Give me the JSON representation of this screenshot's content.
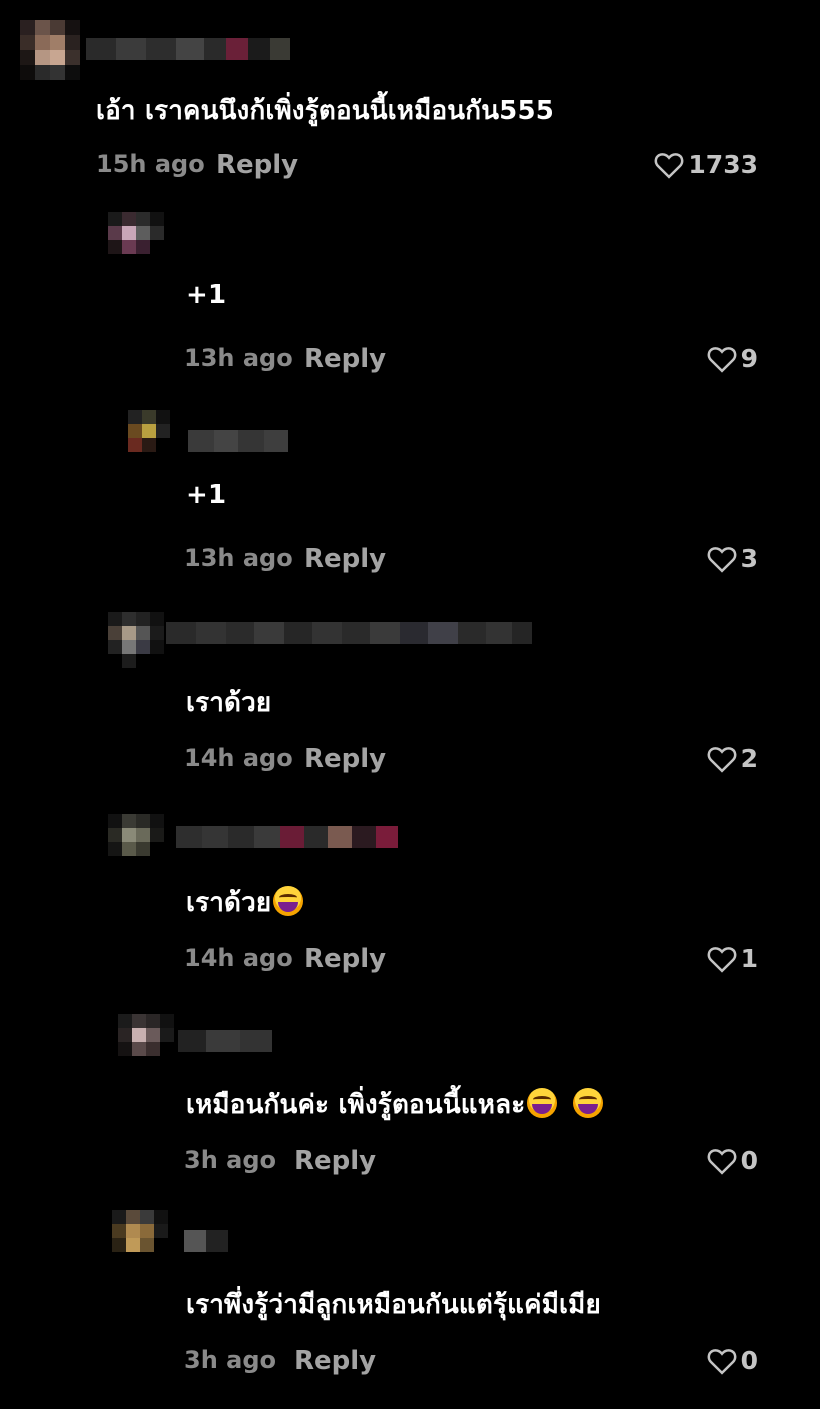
{
  "comments": [
    {
      "text": "เอ้า เราคนนึงก้เพิ่งรู้ตอนนี้เหมือนกัน555",
      "time": "15h ago",
      "reply": "Reply",
      "likes": "1733"
    },
    {
      "text": "+1",
      "time": "13h ago",
      "reply": "Reply",
      "likes": "9"
    },
    {
      "text": "+1",
      "time": "13h ago",
      "reply": "Reply",
      "likes": "3"
    },
    {
      "text": "เราด้วย",
      "time": "14h ago",
      "reply": "Reply",
      "likes": "2"
    },
    {
      "text": "เราด้วย",
      "time": "14h ago",
      "reply": "Reply",
      "likes": "1"
    },
    {
      "text": "เหมือนกันค่ะ เพิ่งรู้ตอนนี้แหละ",
      "time": "3h ago",
      "reply": "Reply",
      "likes": "0"
    },
    {
      "text": "เราพึ่งรู้ว่ามีลูกเหมือนกันแต่รุ้แค่มีเมีย",
      "time": "3h ago",
      "reply": "Reply",
      "likes": "0"
    }
  ],
  "icons": {
    "like": "heart-outline-icon",
    "emoji": "grinning-face-with-tears-emoji"
  }
}
